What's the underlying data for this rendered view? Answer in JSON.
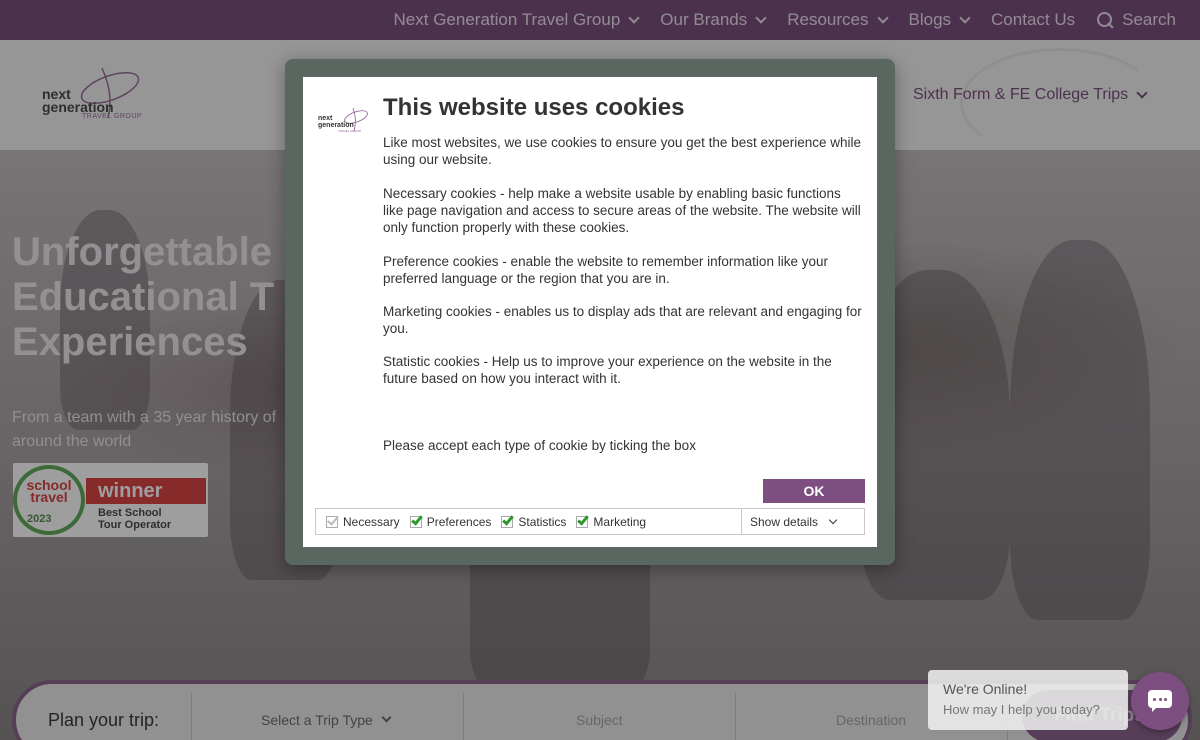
{
  "topbar": {
    "items": [
      {
        "label": "Next Generation Travel Group",
        "dropdown": true
      },
      {
        "label": "Our Brands",
        "dropdown": true
      },
      {
        "label": "Resources",
        "dropdown": true
      },
      {
        "label": "Blogs",
        "dropdown": true
      },
      {
        "label": "Contact Us",
        "dropdown": false
      }
    ],
    "search_label": "Search",
    "search_icon": "search-icon"
  },
  "header": {
    "logo_text": "next generation",
    "logo_subtext": "TRAVEL GROUP",
    "nav_item": "Sixth Form & FE College Trips"
  },
  "hero": {
    "title": "Unforgettable\nEducational T\nExperiences",
    "subtitle": "From a team with a 35 year history of around the world"
  },
  "award": {
    "school": "school travel",
    "awards": "AWARDS",
    "year": "2023",
    "winner": "winner",
    "line1": "Best School",
    "line2": "Tour Operator"
  },
  "planner": {
    "label": "Plan your trip:",
    "trip_type": "Select a Trip Type",
    "subject": "Subject",
    "destination": "Destination",
    "find_button": "Find Trips"
  },
  "chat": {
    "line1": "We're Online!",
    "line2": "How may I help you today?",
    "icon": "chat-icon"
  },
  "cookie": {
    "title": "This website uses cookies",
    "paragraphs": [
      "Like most websites, we use cookies to ensure you get the best experience while using our website.",
      "Necessary cookies - help make a website usable by enabling basic functions like page navigation and access to secure areas of the website. The website will only function properly with these cookies.",
      "Preference cookies - enable the website to remember information like your preferred language or the region that you are in.",
      "Marketing cookies - enables us to display ads that are relevant and engaging for you.",
      "Statistic cookies - Help us to improve your experience on the website in the future based on how you interact with it.",
      "Please accept each type of cookie by ticking the box"
    ],
    "ok_label": "OK",
    "options": [
      {
        "label": "Necessary",
        "checked": true,
        "disabled": true
      },
      {
        "label": "Preferences",
        "checked": true,
        "disabled": false
      },
      {
        "label": "Statistics",
        "checked": true,
        "disabled": false
      },
      {
        "label": "Marketing",
        "checked": true,
        "disabled": false
      }
    ],
    "show_details": "Show details"
  },
  "colors": {
    "brand_purple": "#7d4f80",
    "topbar": "#6b3a6e",
    "check_green": "#2a9a2a"
  }
}
